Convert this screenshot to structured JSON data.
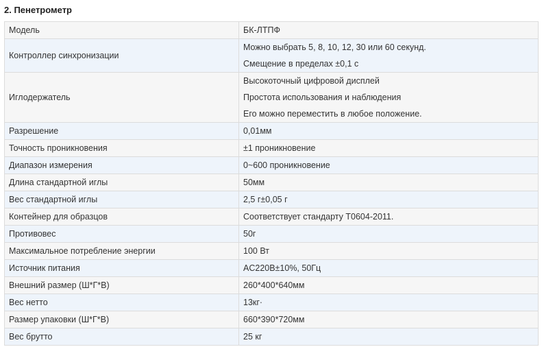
{
  "section": {
    "title": "2. Пенетрометр"
  },
  "table": {
    "rows": [
      {
        "label": "Модель",
        "values": [
          "БК-ЛТПФ"
        ]
      },
      {
        "label": "Контроллер синхронизации",
        "values": [
          "Можно выбрать 5, 8, 10, 12, 30 или 60 секунд.",
          "Смещение в пределах ±0,1 с"
        ]
      },
      {
        "label": "Иглодержатель",
        "values": [
          "Высокоточный цифровой дисплей",
          "Простота использования и наблюдения",
          "Его можно переместить в любое положение."
        ]
      },
      {
        "label": "Разрешение",
        "values": [
          "0,01мм"
        ]
      },
      {
        "label": "Точность проникновения",
        "values": [
          "±1 проникновение"
        ]
      },
      {
        "label": "Диапазон измерения",
        "values": [
          "0~600 проникновение"
        ]
      },
      {
        "label": "Длина стандартной иглы",
        "values": [
          "50мм"
        ]
      },
      {
        "label": "Вес стандартной иглы",
        "values": [
          "2,5 г±0,05 г"
        ]
      },
      {
        "label": "Контейнер для образцов",
        "values": [
          "Соответствует стандарту T0604-2011."
        ]
      },
      {
        "label": "Противовес",
        "values": [
          "50г"
        ]
      },
      {
        "label": "Максимальное потребление энергии",
        "values": [
          "100 Вт"
        ]
      },
      {
        "label": "Источник питания",
        "values": [
          "AC220В±10%, 50Гц"
        ]
      },
      {
        "label": "Внешний размер (Ш*Г*В)",
        "values": [
          "260*400*640мм"
        ]
      },
      {
        "label": "Вес нетто",
        "values": [
          "13кг·"
        ]
      },
      {
        "label": "Размер упаковки (Ш*Г*В)",
        "values": [
          "660*390*720мм"
        ]
      },
      {
        "label": "Вес брутто",
        "values": [
          "25 кг"
        ]
      }
    ]
  }
}
